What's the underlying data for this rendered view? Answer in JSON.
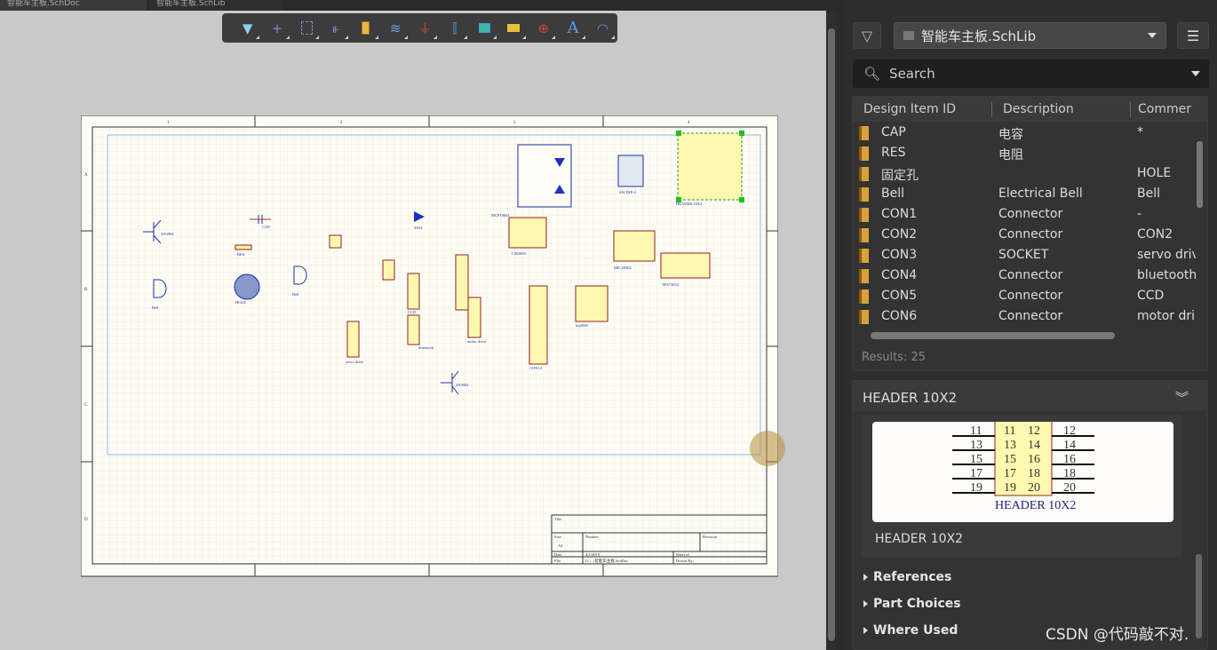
{
  "tabs": [
    "智能车主板.SchDoc",
    "智能车主板.SchLib"
  ],
  "toolbar": {
    "icons": [
      "filter-icon",
      "cross-icon",
      "select-rect-icon",
      "align-icon",
      "part-icon",
      "bus-icon",
      "gnd-icon",
      "port-icon",
      "sheet-icon",
      "net-label-icon",
      "probe-icon",
      "text-icon",
      "arc-icon"
    ],
    "text_glyph": "A"
  },
  "schematic": {
    "col_labels": [
      "1",
      "2",
      "3",
      "4"
    ],
    "row_labels": [
      "A",
      "B",
      "C",
      "D"
    ],
    "labels": [
      "Q?",
      "2N3904",
      "C?",
      "CAP",
      "R?",
      "RES",
      "LS?",
      "Bell",
      "M?",
      "HOLE",
      "LS?",
      "Bell",
      "D?",
      "SS34",
      "U?",
      "MCP10601",
      "GND",
      "S?",
      "SW DIP-4",
      "SW-SPST",
      "HEADER 10X2",
      "LM2660",
      "U?",
      "MIC29302",
      "TPS73633",
      "CON2",
      "CCD",
      "servo drive",
      "bluetooth",
      "motor drive",
      "CON12",
      "lm2940",
      "Q?",
      "2N3904"
    ],
    "title_block": {
      "title": "Title",
      "size": "Size",
      "size_val": "A4",
      "number": "Number",
      "revision": "Revision",
      "date": "Date",
      "date_val": "4/1/2019",
      "file": "File",
      "file_val": "G:\\...\\智能车主板.SchDoc",
      "sheet": "Sheet  of",
      "drawn_by": "Drawn By:"
    }
  },
  "panel": {
    "library": "智能车主板.SchLib",
    "search_placeholder": "Search",
    "columns": [
      "Design Item ID",
      "Description",
      "Commer"
    ],
    "rows": [
      {
        "id": "CAP",
        "desc": "电容",
        "comment": "*"
      },
      {
        "id": "RES",
        "desc": "电阻",
        "comment": ""
      },
      {
        "id": "固定孔",
        "desc": "",
        "comment": "HOLE"
      },
      {
        "id": "Bell",
        "desc": "Electrical Bell",
        "comment": "Bell"
      },
      {
        "id": "CON1",
        "desc": "Connector",
        "comment": "-"
      },
      {
        "id": "CON2",
        "desc": "Connector",
        "comment": "CON2"
      },
      {
        "id": "CON3",
        "desc": "SOCKET",
        "comment": "servo driv"
      },
      {
        "id": "CON4",
        "desc": "Connector",
        "comment": "bluetooth"
      },
      {
        "id": "CON5",
        "desc": "Connector",
        "comment": "CCD"
      },
      {
        "id": "CON6",
        "desc": "Connector",
        "comment": "motor dri"
      }
    ],
    "results": "Results: 25",
    "selected": "HEADER 10X2",
    "preview": {
      "pins_left": [
        "11",
        "13",
        "15",
        "17",
        "19"
      ],
      "pins_right": [
        "12",
        "14",
        "16",
        "18",
        "20"
      ],
      "inner": [
        [
          "11",
          "12"
        ],
        [
          "13",
          "14"
        ],
        [
          "15",
          "16"
        ],
        [
          "17",
          "18"
        ],
        [
          "19",
          "20"
        ]
      ],
      "name": "HEADER 10X2"
    },
    "selected_name": "HEADER 10X2",
    "sections": [
      "References",
      "Part Choices",
      "Where Used"
    ]
  },
  "watermark": "CSDN @代码敲不对."
}
